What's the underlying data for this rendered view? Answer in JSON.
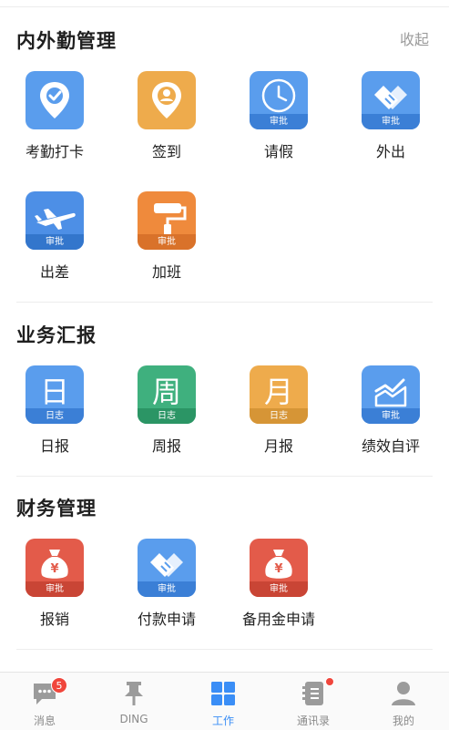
{
  "sections": {
    "attendance": {
      "title": "内外勤管理",
      "collapse_label": "收起",
      "items": [
        {
          "label": "考勤打卡",
          "band": "",
          "color": "#5a9ded",
          "icon": "location-check-icon"
        },
        {
          "label": "签到",
          "band": "",
          "color": "#eeab4c",
          "icon": "location-person-icon"
        },
        {
          "label": "请假",
          "band": "审批",
          "color": "#5a9ded",
          "icon": "clock-icon"
        },
        {
          "label": "外出",
          "band": "审批",
          "color": "#5a9ded",
          "icon": "handshake-icon"
        },
        {
          "label": "出差",
          "band": "审批",
          "color": "#4d8fe6",
          "icon": "airplane-icon"
        },
        {
          "label": "加班",
          "band": "审批",
          "color": "#ef8a3c",
          "icon": "paint-roller-icon"
        }
      ]
    },
    "reports": {
      "title": "业务汇报",
      "items": [
        {
          "label": "日报",
          "band": "日志",
          "glyph": "日",
          "color": "#5a9ded",
          "icon": "daily-report-icon"
        },
        {
          "label": "周报",
          "band": "日志",
          "glyph": "周",
          "color": "#3fb07e",
          "icon": "weekly-report-icon"
        },
        {
          "label": "月报",
          "band": "日志",
          "glyph": "月",
          "color": "#eeab4c",
          "icon": "monthly-report-icon"
        },
        {
          "label": "绩效自评",
          "band": "审批",
          "color": "#5a9ded",
          "icon": "chart-trend-icon"
        }
      ]
    },
    "finance": {
      "title": "财务管理",
      "items": [
        {
          "label": "报销",
          "band": "审批",
          "color": "#e35b4a",
          "icon": "money-bag-icon",
          "glyph": "¥"
        },
        {
          "label": "付款申请",
          "band": "审批",
          "color": "#5a9ded",
          "icon": "handshake-icon"
        },
        {
          "label": "备用金申请",
          "band": "审批",
          "color": "#e35b4a",
          "icon": "money-bag-icon",
          "glyph": "¥"
        }
      ]
    }
  },
  "tabbar": {
    "items": [
      {
        "label": "消息",
        "icon": "chat-icon",
        "badge": "5"
      },
      {
        "label": "DING",
        "icon": "pin-icon"
      },
      {
        "label": "工作",
        "icon": "grid-icon",
        "active": true
      },
      {
        "label": "通讯录",
        "icon": "contacts-icon",
        "dot": true
      },
      {
        "label": "我的",
        "icon": "person-icon"
      }
    ]
  }
}
